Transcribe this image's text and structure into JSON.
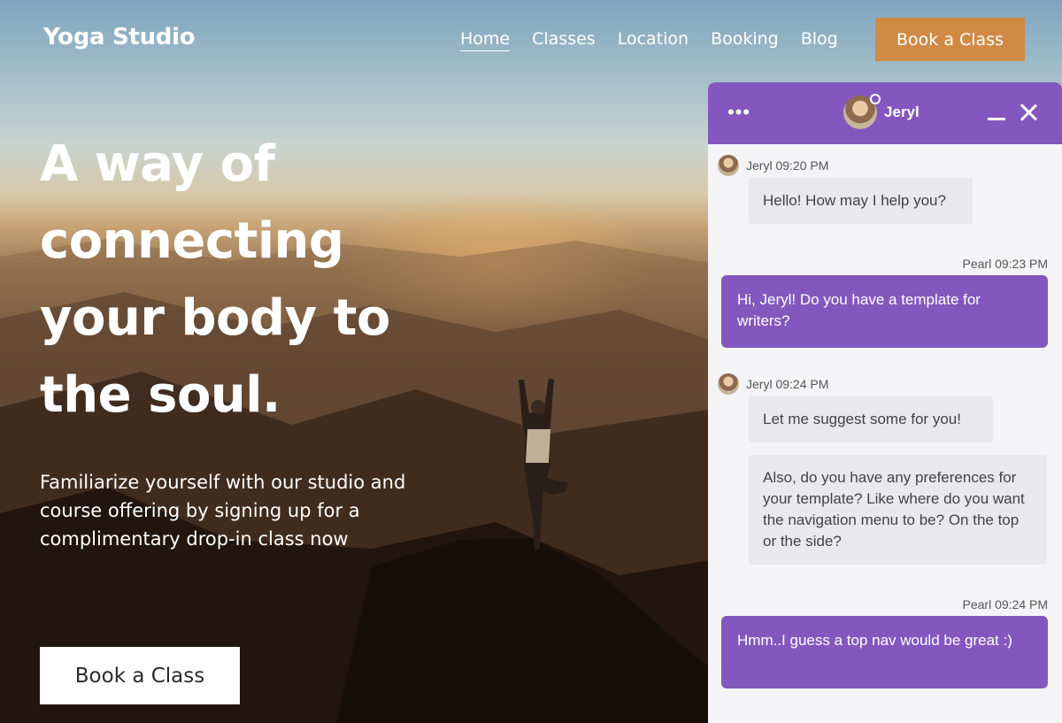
{
  "brand": "Yoga Studio",
  "nav": {
    "links": [
      "Home",
      "Classes",
      "Location",
      "Booking",
      "Blog"
    ],
    "active": "Home",
    "cta": "Book a Class"
  },
  "hero": {
    "title_lines": [
      "A way of",
      "connecting",
      "your body to",
      "the soul."
    ],
    "subtitle": "Familiarize yourself with our studio and course offering by signing up for a complimentary drop-in class now",
    "cta": "Book a Class"
  },
  "chat": {
    "menu_icon": "more-horizontal-icon",
    "agent_name": "Jeryl",
    "accent": "#8457be",
    "messages": [
      {
        "sender": "Jeryl",
        "time": "09:20 PM",
        "meta": "Jeryl 09:20 PM",
        "text": "Hello! How may I help you?"
      },
      {
        "sender": "Pearl",
        "time": "09:23 PM",
        "meta": "Pearl 09:23 PM",
        "text": "Hi, Jeryl! Do you have a template for writers?"
      },
      {
        "sender": "Jeryl",
        "time": "09:24 PM",
        "meta": "Jeryl 09:24 PM",
        "text": "Let me suggest some for you!"
      },
      {
        "sender": "Jeryl",
        "text": "Also, do you have any preferences for your template? Like where do you want the navigation menu to be? On the top or the side?"
      },
      {
        "sender": "Pearl",
        "time": "09:24 PM",
        "meta": "Pearl 09:24 PM",
        "text": "Hmm..I guess a top nav would be great :)"
      }
    ]
  },
  "colors": {
    "cta_orange": "#d08a45",
    "chat_purple": "#8457be",
    "bubble_gray": "#e8e8ed"
  }
}
